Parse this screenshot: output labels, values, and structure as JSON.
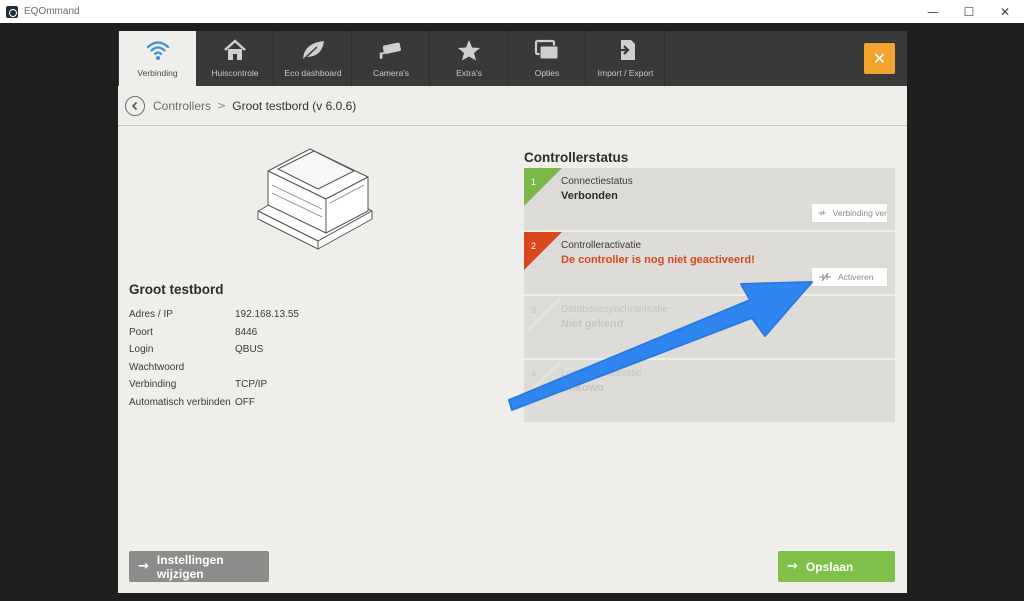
{
  "window": {
    "app_title": "EQOmmand",
    "minimize": "—",
    "maximize": "☐",
    "close": "✕"
  },
  "tabs": [
    {
      "label": "Verbinding",
      "icon": "wifi-icon",
      "active": true
    },
    {
      "label": "Huiscontrole",
      "icon": "house-icon"
    },
    {
      "label": "Eco dashboard",
      "icon": "leaf-icon"
    },
    {
      "label": "Camera's",
      "icon": "camera-icon"
    },
    {
      "label": "Extra's",
      "icon": "star-icon"
    },
    {
      "label": "Opties",
      "icon": "windows-icon"
    },
    {
      "label": "Import / Export",
      "icon": "import-export-icon"
    }
  ],
  "close_button": "✕",
  "breadcrumb": {
    "root": "Controllers",
    "separator": ">",
    "current": "Groot testbord (v 6.0.6)"
  },
  "controller": {
    "name": "Groot testbord",
    "properties": [
      {
        "key": "Adres / IP",
        "value": "192.168.13.55"
      },
      {
        "key": "Poort",
        "value": "8446"
      },
      {
        "key": "Login",
        "value": "QBUS"
      },
      {
        "key": "Wachtwoord",
        "value": ""
      },
      {
        "key": "Verbinding",
        "value": "TCP/IP"
      },
      {
        "key": "Automatisch verbinden",
        "value": "OFF"
      }
    ]
  },
  "status": {
    "title": "Controllerstatus",
    "steps": [
      {
        "num": "1",
        "label": "Connectiestatus",
        "value": "Verbonden",
        "action": "Verbinding ver",
        "color": "#7ab648"
      },
      {
        "num": "2",
        "label": "Controlleractivatie",
        "value": "De controller is nog niet geactiveerd!",
        "action": "Activeren",
        "color": "#d9481c"
      },
      {
        "num": "3",
        "label": "Databasesynchronisatie",
        "value": "Niet gekend"
      },
      {
        "num": "4",
        "label": "Logsynchronisatie",
        "value": "Unkown"
      }
    ]
  },
  "buttons": {
    "settings": "Instellingen wijzigen",
    "save": "Opslaan",
    "arrow": "→"
  },
  "colors": {
    "accent_orange": "#f0a32f",
    "success_green": "#7ec04a",
    "error_red": "#d9481c",
    "annotation_blue": "#2f86f0"
  }
}
